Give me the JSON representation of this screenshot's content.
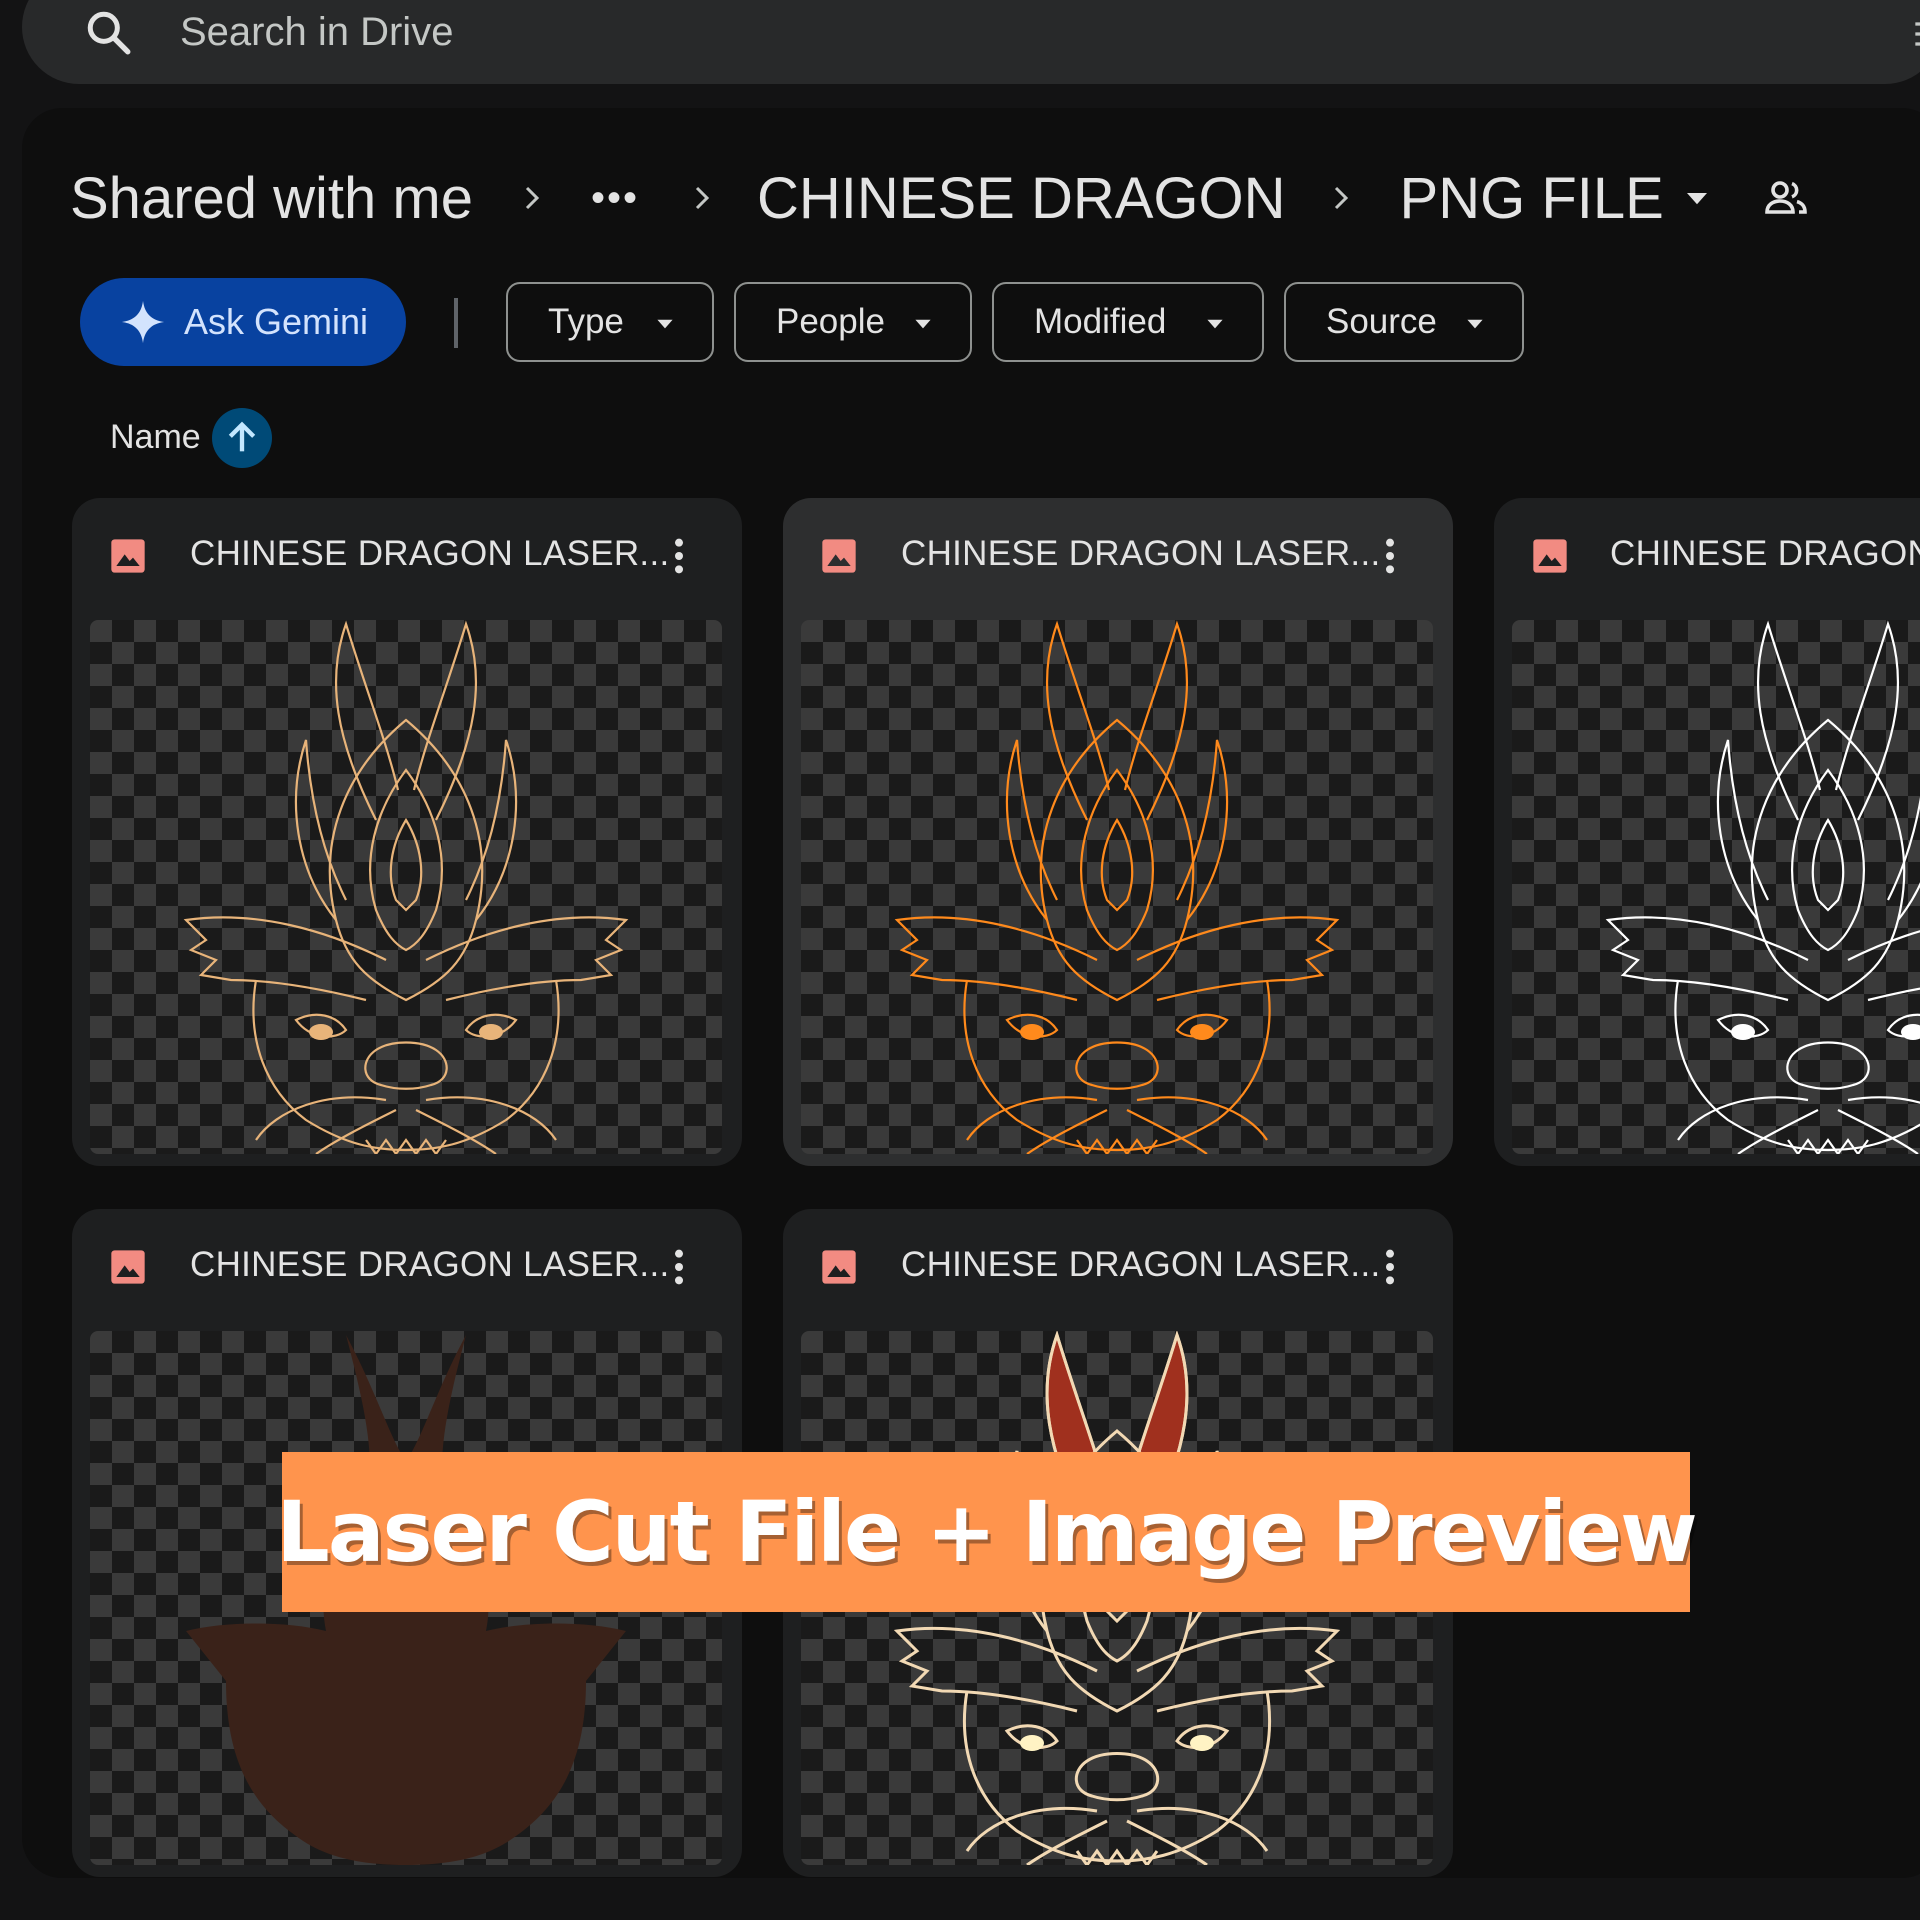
{
  "search": {
    "placeholder": "Search in Drive"
  },
  "breadcrumb": {
    "root": "Shared with me",
    "ellipsis": "•••",
    "folder": "CHINESE DRAGON",
    "current": "PNG FILE"
  },
  "filters": {
    "ask_gemini": "Ask Gemini",
    "chips": [
      "Type",
      "People",
      "Modified",
      "Source"
    ]
  },
  "sort": {
    "label": "Name",
    "direction": "ascending"
  },
  "files": [
    {
      "title": "CHINESE DRAGON LASER...",
      "line_color": "#e8b47a",
      "fill": "none"
    },
    {
      "title": "CHINESE DRAGON LASER...",
      "line_color": "#ff8a1c",
      "fill": "none",
      "selected": true
    },
    {
      "title": "CHINESE DRAGON",
      "line_color": "#ffffff",
      "fill": "none"
    },
    {
      "title": "CHINESE DRAGON LASER...",
      "line_color": "#3a2219",
      "fill": "solid"
    },
    {
      "title": "CHINESE DRAGON LASER...",
      "line_color": "#f2d9b4",
      "fill": "color"
    }
  ],
  "banner": {
    "text": "Laser Cut File + Image Preview"
  },
  "colors": {
    "accent_gemini": "#0842a0",
    "file_icon": "#f28b82",
    "banner_bg": "#ff944d"
  }
}
